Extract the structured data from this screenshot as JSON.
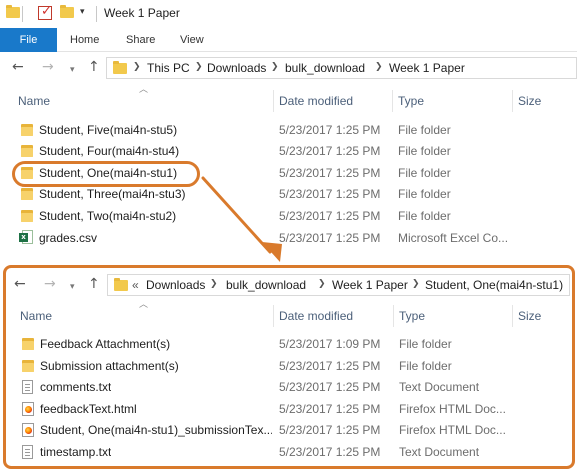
{
  "top_window": {
    "title": "Week 1 Paper",
    "ribbon": {
      "file": "File",
      "home": "Home",
      "share": "Share",
      "view": "View"
    },
    "breadcrumb": [
      "This PC",
      "Downloads",
      "bulk_download",
      "Week 1 Paper"
    ],
    "columns": {
      "name": "Name",
      "date": "Date modified",
      "type": "Type",
      "size": "Size"
    },
    "files": [
      {
        "name": "Student, Five(mai4n-stu5)",
        "date": "5/23/2017 1:25 PM",
        "type": "File folder",
        "icon": "folder-icon"
      },
      {
        "name": "Student, Four(mai4n-stu4)",
        "date": "5/23/2017 1:25 PM",
        "type": "File folder",
        "icon": "folder-icon"
      },
      {
        "name": "Student, One(mai4n-stu1)",
        "date": "5/23/2017 1:25 PM",
        "type": "File folder",
        "icon": "folder-icon"
      },
      {
        "name": "Student, Three(mai4n-stu3)",
        "date": "5/23/2017 1:25 PM",
        "type": "File folder",
        "icon": "folder-icon"
      },
      {
        "name": "Student, Two(mai4n-stu2)",
        "date": "5/23/2017 1:25 PM",
        "type": "File folder",
        "icon": "folder-icon"
      },
      {
        "name": "grades.csv",
        "date": "5/23/2017 1:25 PM",
        "type": "Microsoft Excel Co...",
        "icon": "excel-file-icon"
      }
    ]
  },
  "bottom_window": {
    "breadcrumb_overflow": "«",
    "breadcrumb": [
      "Downloads",
      "bulk_download",
      "Week 1 Paper",
      "Student, One(mai4n-stu1)"
    ],
    "columns": {
      "name": "Name",
      "date": "Date modified",
      "type": "Type",
      "size": "Size"
    },
    "files": [
      {
        "name": "Feedback Attachment(s)",
        "date": "5/23/2017 1:09 PM",
        "type": "File folder",
        "icon": "folder-icon"
      },
      {
        "name": "Submission attachment(s)",
        "date": "5/23/2017 1:25 PM",
        "type": "File folder",
        "icon": "folder-icon"
      },
      {
        "name": "comments.txt",
        "date": "5/23/2017 1:25 PM",
        "type": "Text Document",
        "icon": "text-file-icon"
      },
      {
        "name": "feedbackText.html",
        "date": "5/23/2017 1:25 PM",
        "type": "Firefox HTML Doc...",
        "icon": "firefox-html-icon"
      },
      {
        "name": "Student, One(mai4n-stu1)_submissionTex...",
        "date": "5/23/2017 1:25 PM",
        "type": "Firefox HTML Doc...",
        "icon": "firefox-html-icon"
      },
      {
        "name": "timestamp.txt",
        "date": "5/23/2017 1:25 PM",
        "type": "Text Document",
        "icon": "text-file-icon"
      }
    ]
  },
  "colors": {
    "accent": "#1979ca",
    "annotation": "#d97a2c",
    "header_text": "#4c607a"
  }
}
